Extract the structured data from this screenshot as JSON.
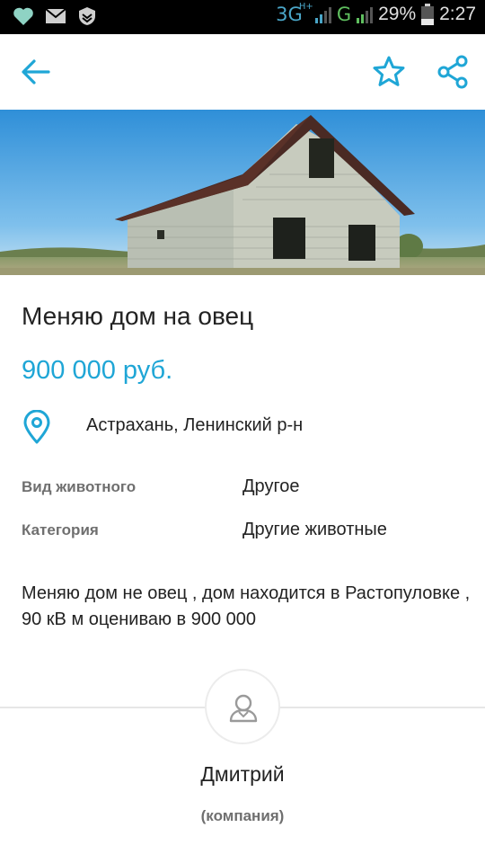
{
  "status_bar": {
    "icons": [
      "heart-icon",
      "mail-icon",
      "shield-icon"
    ],
    "network_1": "3G",
    "network_1_sup": "H+",
    "network_2": "G",
    "battery": "29%",
    "time": "2:27"
  },
  "app_bar": {
    "back_icon": "arrow-left-icon",
    "favorite_icon": "star-outline-icon",
    "share_icon": "share-icon",
    "accent_color": "#1fa6d6"
  },
  "listing": {
    "title": "Меняю дом на овец",
    "price": "900 000 руб.",
    "location": "Астрахань, Ленинский р-н",
    "properties": [
      {
        "label": "Вид животного",
        "value": "Другое"
      },
      {
        "label": "Категория",
        "value": "Другие животные"
      }
    ],
    "description": "Меняю дом не овец , дом находится в Растопуловке , 90 кВ м оцениваю в 900 000"
  },
  "seller": {
    "name": "Дмитрий",
    "type": "(компания)"
  }
}
